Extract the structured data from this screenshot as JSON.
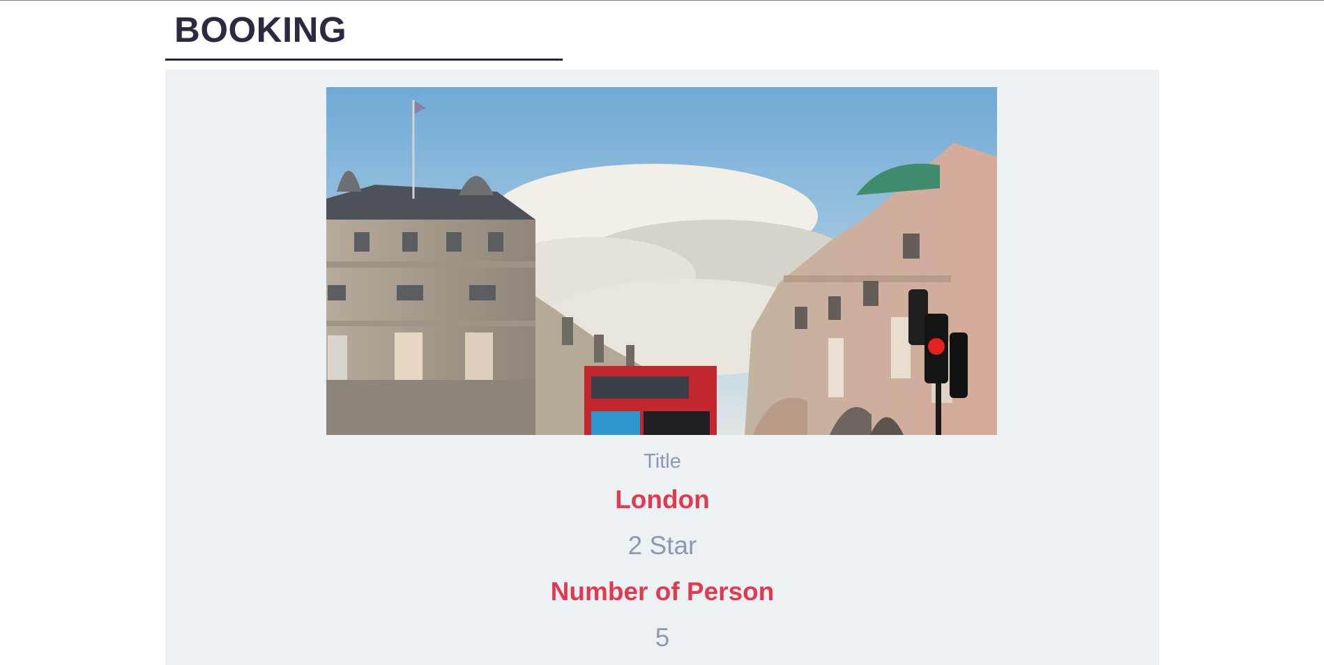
{
  "header": {
    "title": "BOOKING"
  },
  "booking": {
    "image": {
      "subject": "london-street-photo"
    },
    "title_label": "Title",
    "city": "London",
    "rating": "2 Star",
    "persons_label": "Number of Person",
    "persons_value": "5"
  },
  "colors": {
    "title_text": "#2a2a40",
    "accent_red": "#e2394f",
    "muted_text": "#8e99b1",
    "card_background": "#ecf1f4"
  }
}
